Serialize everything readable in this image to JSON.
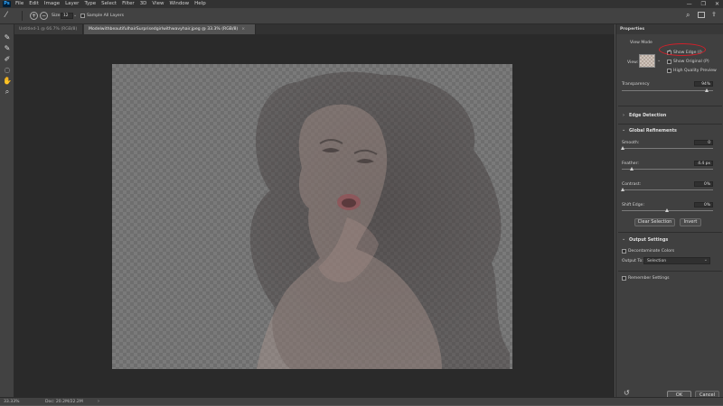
{
  "app": {
    "logo": "Ps"
  },
  "menu": [
    "File",
    "Edit",
    "Image",
    "Layer",
    "Type",
    "Select",
    "Filter",
    "3D",
    "View",
    "Window",
    "Help"
  ],
  "window_controls": {
    "minimize": "—",
    "restore": "❐",
    "close": "✕"
  },
  "options": {
    "size_label": "Size:",
    "size_value": "12",
    "sample_all_layers": "Sample All Layers"
  },
  "tabs": [
    {
      "label": "Untitled-1 @ 66.7% (RGB/8)"
    },
    {
      "label": "ModelwithbeautifulhairSurprisedgirlwithwavyhair.jpeg @ 33.3% (RGB/8)"
    }
  ],
  "status": {
    "zoom": "33.33%",
    "doc": "Doc: 20.2M/22.2M"
  },
  "properties": {
    "panel_title": "Properties",
    "view_mode_heading": "View Mode",
    "view_label": "View:",
    "show_edge": "Show Edge (J)",
    "show_original": "Show Original (P)",
    "high_quality_preview": "High Quality Preview",
    "transparency_label": "Transparency",
    "transparency_value": "94%",
    "transparency": 0.94,
    "edge_detection": "Edge Detection",
    "global_refinements": "Global Refinements",
    "smooth_label": "Smooth:",
    "smooth_value": "0",
    "feather_label": "Feather:",
    "feather_value": "4.4 px",
    "contrast_label": "Contrast:",
    "contrast_value": "0%",
    "shift_edge_label": "Shift Edge:",
    "shift_edge_value": "0%",
    "clear_selection": "Clear Selection",
    "invert": "Invert",
    "output_settings": "Output Settings",
    "decontaminate_colors": "Decontaminate Colors",
    "output_to_label": "Output To:",
    "output_to_value": "Selection",
    "remember_settings": "Remember Settings",
    "ok": "OK",
    "cancel": "Cancel"
  },
  "colors": {
    "annotation": "#d0202a",
    "panel_bg": "#404040",
    "canvas_bg": "#2a2a2a"
  }
}
